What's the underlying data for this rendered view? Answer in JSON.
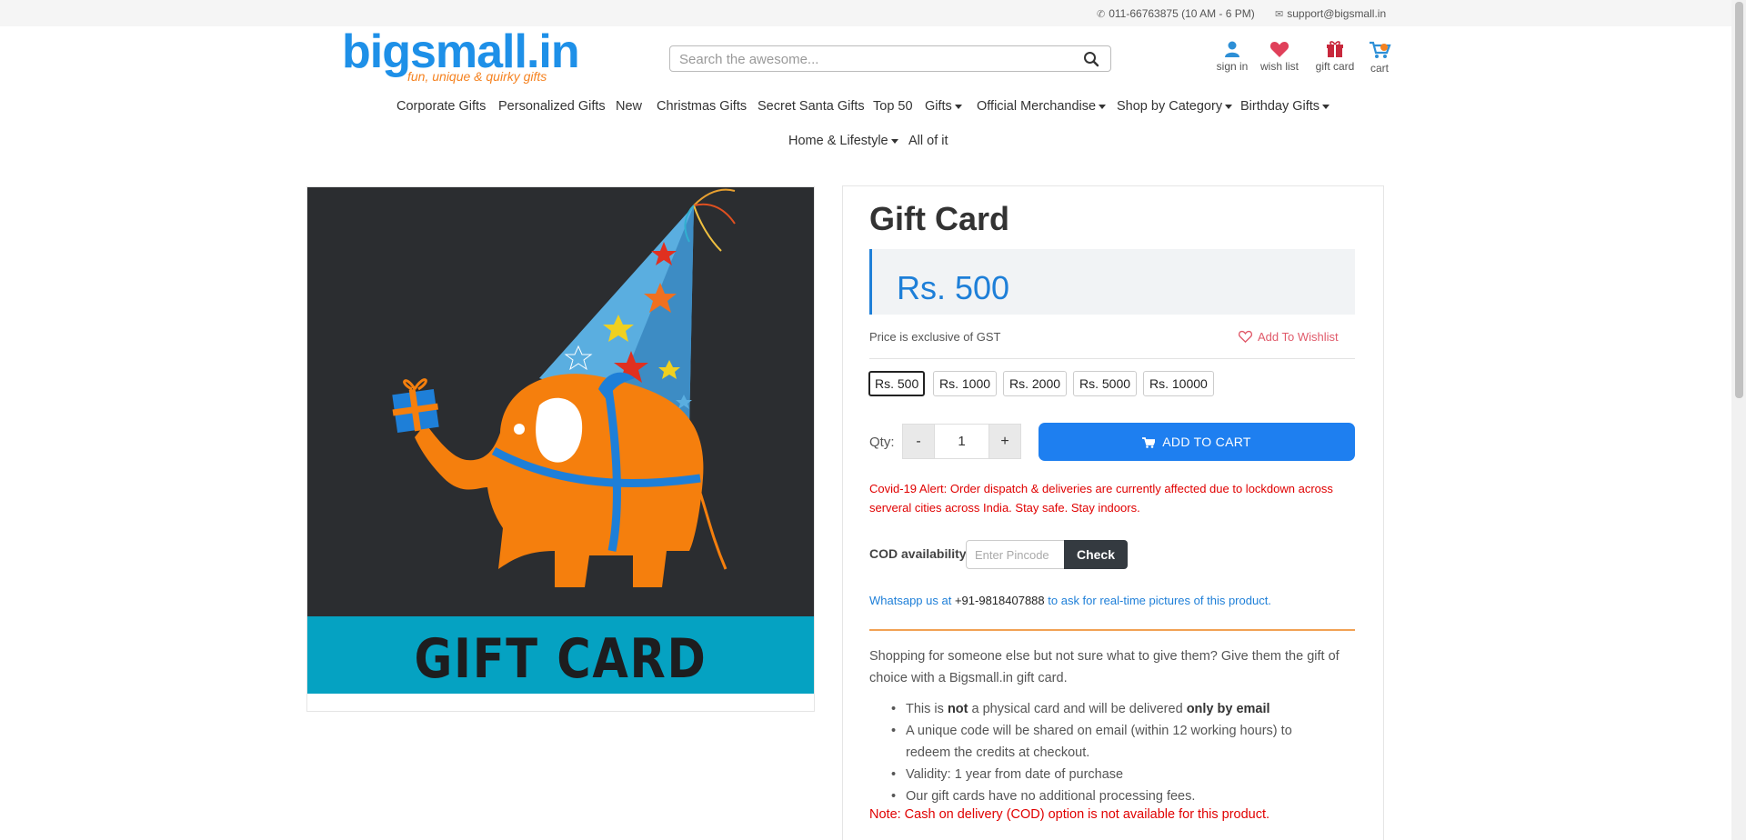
{
  "topbar": {
    "phone": "011-66763875 (10 AM - 6 PM)",
    "email": "support@bigsmall.in"
  },
  "logo": {
    "wordmark": "bigsmall.in",
    "tagline": "fun, unique & quirky gifts"
  },
  "search": {
    "placeholder": "Search the awesome...",
    "value": ""
  },
  "header_icons": {
    "sign_in": "sign in",
    "wish_list": "wish list",
    "gift_card": "gift card",
    "cart": "cart"
  },
  "nav": {
    "items": [
      {
        "label": "Corporate Gifts",
        "dropdown": false
      },
      {
        "label": "Personalized Gifts",
        "dropdown": false
      },
      {
        "label": "New",
        "dropdown": false
      },
      {
        "label": "Christmas Gifts",
        "dropdown": false
      },
      {
        "label": "Secret Santa Gifts",
        "dropdown": false
      },
      {
        "label": "Top 50",
        "dropdown": false
      },
      {
        "label": "Gifts",
        "dropdown": true
      },
      {
        "label": "Official Merchandise",
        "dropdown": true
      },
      {
        "label": "Shop by Category",
        "dropdown": true
      },
      {
        "label": "Birthday Gifts",
        "dropdown": true
      },
      {
        "label": "Home & Lifestyle",
        "dropdown": true
      },
      {
        "label": "All of it",
        "dropdown": false
      }
    ]
  },
  "product": {
    "image_caption": "GIFT CARD",
    "title": "Gift Card",
    "price": "Rs. 500",
    "gst_note": "Price is exclusive of GST",
    "wishlist_label": "Add To Wishlist",
    "denominations": [
      {
        "label": "Rs. 500",
        "selected": true
      },
      {
        "label": "Rs. 1000",
        "selected": false
      },
      {
        "label": "Rs. 2000",
        "selected": false
      },
      {
        "label": "Rs. 5000",
        "selected": false
      },
      {
        "label": "Rs. 10000",
        "selected": false
      }
    ],
    "qty_label": "Qty:",
    "qty_minus": "-",
    "qty_value": "1",
    "qty_plus": "+",
    "add_to_cart": "ADD TO CART",
    "covid_alert": "Covid-19 Alert: Order dispatch & deliveries are currently affected due to lockdown across serveral cities across India. Stay safe. Stay indoors.",
    "cod_label": "COD availability",
    "pincode_placeholder": "Enter Pincode",
    "check_label": "Check",
    "whatsapp_prefix": "Whatsapp us at",
    "whatsapp_number": "+91-9818407888",
    "whatsapp_suffix": "to ask for real-time pictures of this product.",
    "description": "Shopping for someone else but not sure what to give them? Give them the gift of choice with a Bigsmall.in gift card.",
    "bullets": {
      "b1_pre": "This is",
      "b1_not": "not",
      "b1_mid": "a physical card and will be delivered",
      "b1_email": "only by email",
      "b2": "A unique code will be shared on email (within 12 working hours) to redeem the credits at checkout.",
      "b3": "Validity: 1 year from date of purchase",
      "b4": "Our gift cards have no additional processing fees."
    },
    "cod_note": "Note: Cash on delivery (COD) option is not available for this product."
  },
  "colors": {
    "brand_blue": "#1e90e8",
    "brand_orange": "#f58220",
    "cta_blue": "#1e7ff0",
    "alert_red": "#e00000",
    "wishlist_pink": "#e05a6a"
  }
}
